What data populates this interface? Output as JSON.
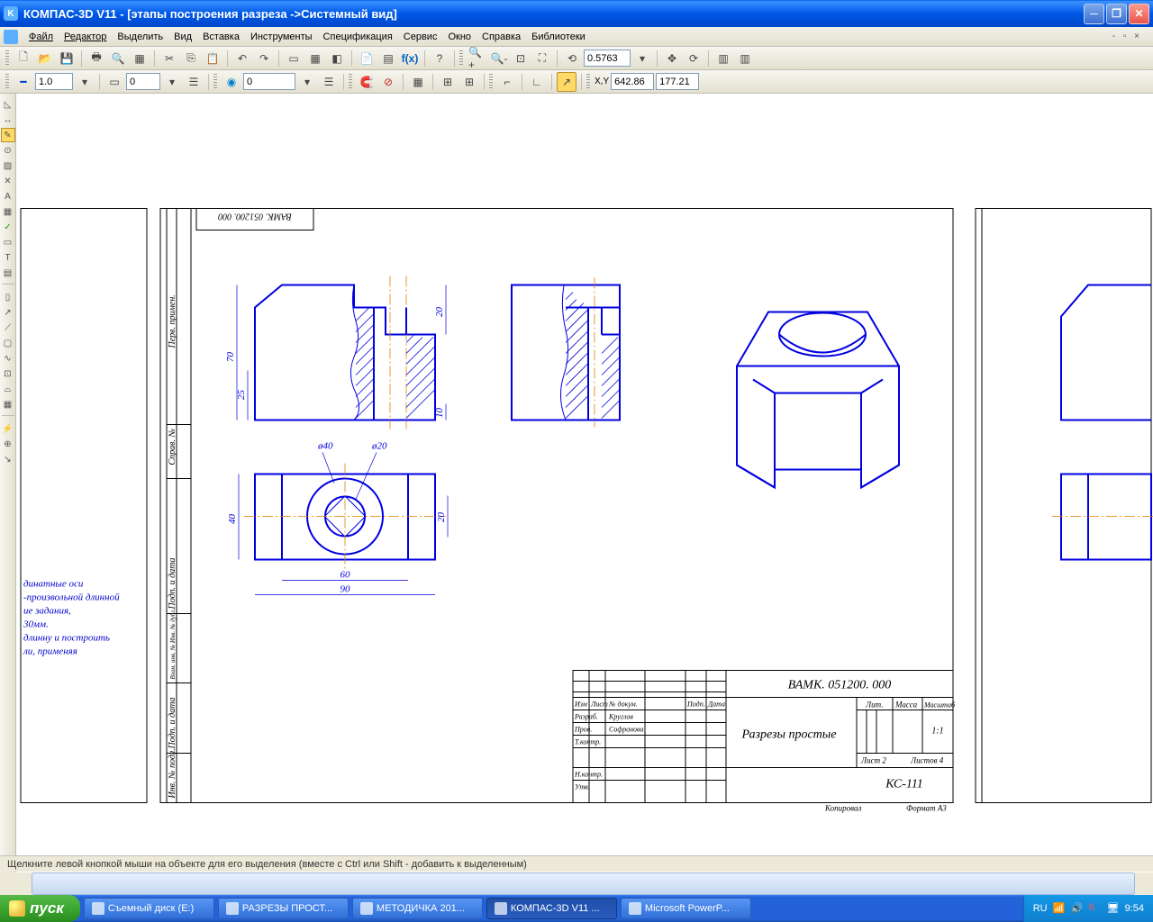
{
  "titlebar": {
    "app": "КОМПАС-3D V11",
    "doc": "[этапы построения разреза ->Системный вид]"
  },
  "menu": [
    "Файл",
    "Редактор",
    "Выделить",
    "Вид",
    "Вставка",
    "Инструменты",
    "Спецификация",
    "Сервис",
    "Окно",
    "Справка",
    "Библиотеки"
  ],
  "toolbar2": {
    "zoom": "0.5763"
  },
  "toolbar3": {
    "style": "1.0",
    "layer": "0",
    "state2": "0",
    "cx": "642.86",
    "cy": "177.21"
  },
  "drawing": {
    "code_rot": "ВАМК. 051200. 000",
    "dims": {
      "d70": "70",
      "d25": "25",
      "d20a": "20",
      "d10": "10",
      "d40": "ø40",
      "d20b": "ø20",
      "d40v": "40",
      "d20c": "20",
      "d60": "60",
      "d90": "90"
    },
    "titleblock": {
      "code": "ВАМК. 051200. 000",
      "name": "Разрезы простые",
      "scale": "1:1",
      "group": "КС-111",
      "sheet": "Лист   2",
      "sheets": "Листов   4",
      "lit": "Лит.",
      "mass": "Масса",
      "masht": "Масштаб",
      "r1": "Изм",
      "r2": "Лист",
      "r3": "№ докум.",
      "r4": "Подп.",
      "r5": "Дата",
      "row1": "Разраб.",
      "row1v": "Круглов",
      "row2": "Пров.",
      "row2v": "Софронова",
      "row3": "Т.контр.",
      "row4": "Н.контр.",
      "row5": "Утв.",
      "kop": "Копировал",
      "fmt": "Формат   А3"
    },
    "side": {
      "l1": "динатные оси",
      "l2": "-произвольной длинной",
      "l3": "ие задания,",
      "l4": "30мм.",
      "l5": "длинну и построить",
      "l6": "ли, применяя"
    },
    "vlabels": {
      "a": "Перв. примен.",
      "b": "Справ. №",
      "c": "Подп. и дата",
      "d": "Взам. инв. № Инв. № дубл.",
      "e": "Подп. и дата",
      "f": "Инв. № подл."
    }
  },
  "statusbar": "Щелкните левой кнопкой мыши на объекте для его выделения (вместе с Ctrl или Shift - добавить к выделенным)",
  "taskbar": {
    "start": "пуск",
    "items": [
      "Съемный диск (E:)",
      "РАЗРЕЗЫ ПРОСТ...",
      "МЕТОДИЧКА 201...",
      "КОМПАС-3D V11 ...",
      "Microsoft PowerP..."
    ],
    "lang": "RU",
    "time": "9:54"
  }
}
